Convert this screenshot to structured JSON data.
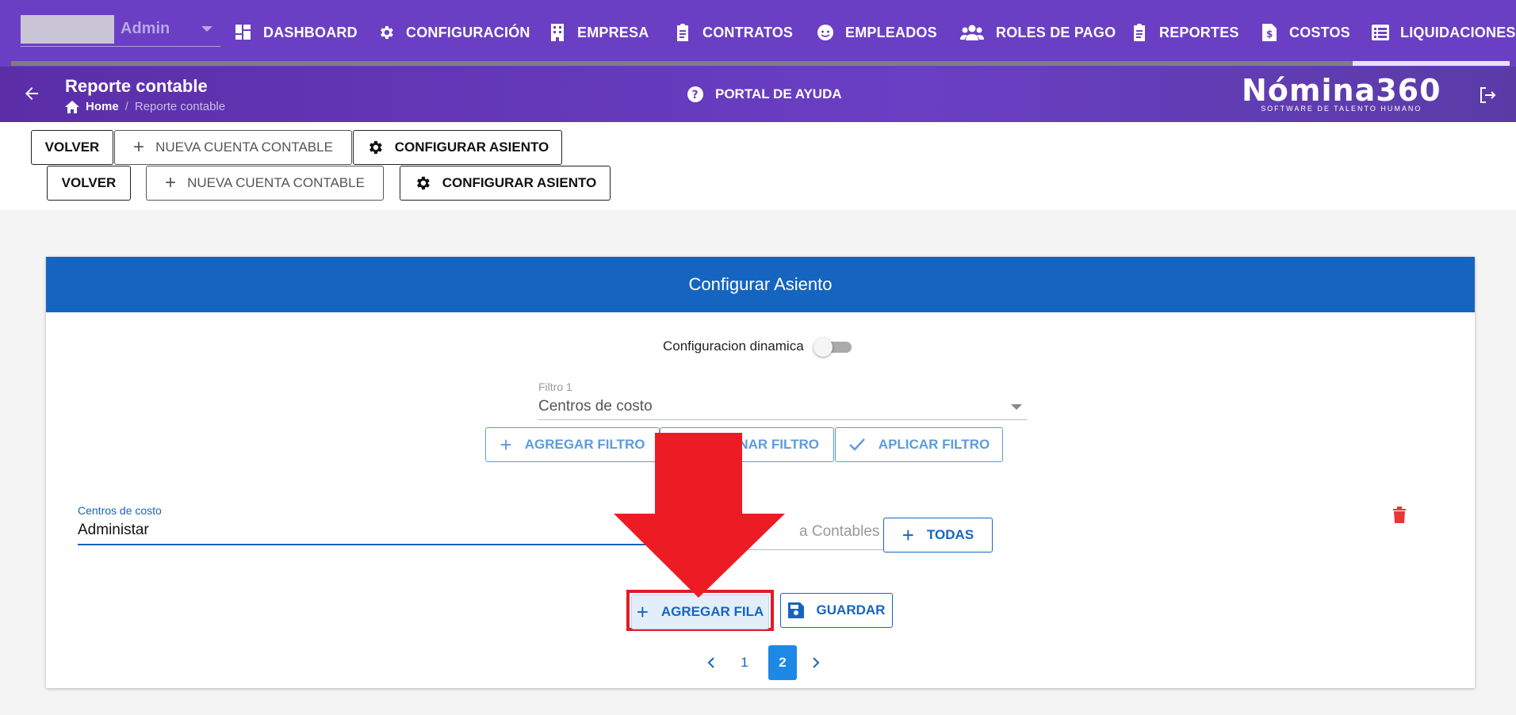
{
  "top_nav": {
    "user_name": "Admin",
    "items": [
      {
        "label": "DASHBOARD",
        "icon": "dashboard-icon"
      },
      {
        "label": "CONFIGURACIÓN",
        "icon": "gear-icon"
      },
      {
        "label": "EMPRESA",
        "icon": "building-icon"
      },
      {
        "label": "CONTRATOS",
        "icon": "clipboard-icon"
      },
      {
        "label": "EMPLEADOS",
        "icon": "face-icon"
      },
      {
        "label": "ROLES DE PAGO",
        "icon": "people-icon"
      },
      {
        "label": "REPORTES",
        "icon": "clipboard-icon"
      },
      {
        "label": "COSTOS",
        "icon": "invoice-icon"
      },
      {
        "label": "LIQUIDACIONES",
        "icon": "list-icon"
      }
    ]
  },
  "header": {
    "title": "Reporte contable",
    "breadcrumb_home": "Home",
    "breadcrumb_sep": "/",
    "breadcrumb_current": "Reporte contable",
    "help_label": "PORTAL DE AYUDA",
    "logo_main": "Nómina360",
    "logo_sub": "SOFTWARE DE TALENTO HUMANO"
  },
  "toolbar": {
    "back_label": "VOLVER",
    "new_account_label": "NUEVA CUENTA CONTABLE",
    "configure_label": "CONFIGURAR ASIENTO"
  },
  "card": {
    "title": "Configurar Asiento",
    "dynamic_toggle_label": "Configuracion dinamica",
    "filter1_label": "Filtro 1",
    "filter1_value": "Centros de costo",
    "add_filter_label": "AGREGAR FILTRO",
    "remove_filter_label": "NAR FILTRO",
    "apply_filter_label": "APLICAR FILTRO",
    "cost_center_label": "Centros de costo",
    "cost_center_value": "Administar",
    "accounts_placeholder": "a Contables",
    "all_label": "TODAS",
    "add_row_label": "AGREGAR FILA",
    "save_label": "GUARDAR",
    "pages": [
      "1",
      "2"
    ],
    "current_page": "2"
  },
  "colors": {
    "nav_purple": "#6a3fc4",
    "header_blue": "#1565c0",
    "arrow_red": "#ed1c24",
    "delete_red": "#e53935"
  }
}
